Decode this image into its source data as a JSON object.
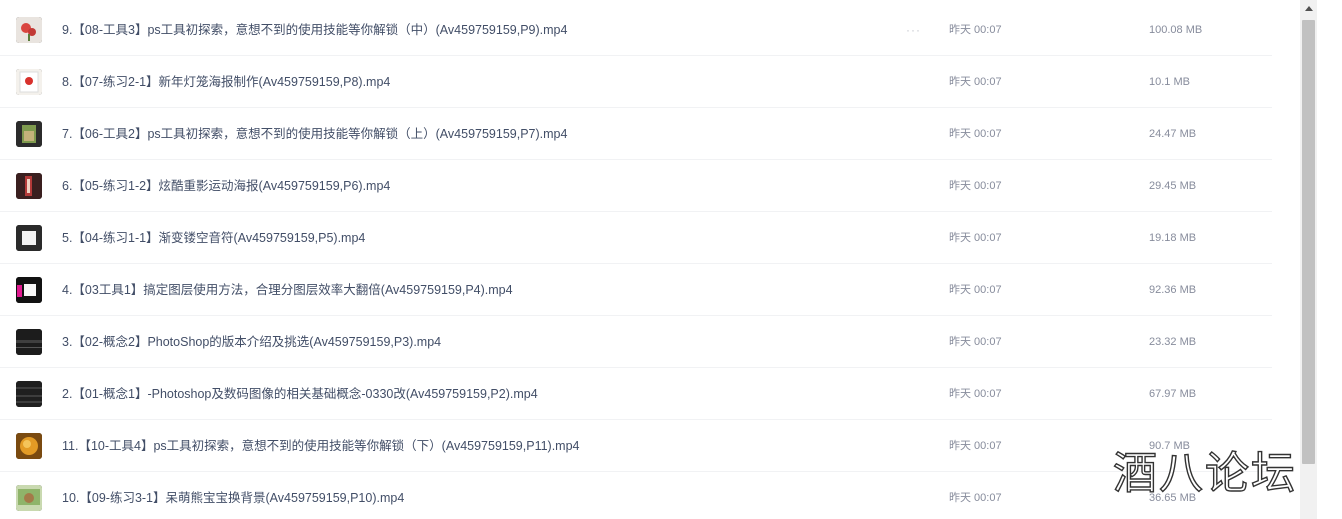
{
  "files": [
    {
      "name": "9.【08-工具3】ps工具初探索，意想不到的使用技能等你解锁（中）(Av459759159,P9).mp4",
      "date": "昨天 00:07",
      "size": "100.08 MB",
      "thumb": "flower-thumbnail"
    },
    {
      "name": "8.【07-练习2-1】新年灯笼海报制作(Av459759159,P8).mp4",
      "date": "昨天 00:07",
      "size": "10.1 MB",
      "thumb": "lantern-poster-thumbnail"
    },
    {
      "name": "7.【06-工具2】ps工具初探索，意想不到的使用技能等你解锁（上）(Av459759159,P7).mp4",
      "date": "昨天 00:07",
      "size": "24.47 MB",
      "thumb": "photo-thumbnail"
    },
    {
      "name": "6.【05-练习1-2】炫酷重影运动海报(Av459759159,P6).mp4",
      "date": "昨天 00:07",
      "size": "29.45 MB",
      "thumb": "sport-poster-thumbnail"
    },
    {
      "name": "5.【04-练习1-1】渐变镂空音符(Av459759159,P5).mp4",
      "date": "昨天 00:07",
      "size": "19.18 MB",
      "thumb": "note-thumbnail"
    },
    {
      "name": "4.【03工具1】搞定图层使用方法，合理分图层效率大翻倍(Av459759159,P4).mp4",
      "date": "昨天 00:07",
      "size": "92.36 MB",
      "thumb": "layers-thumbnail"
    },
    {
      "name": "3.【02-概念2】PhotoShop的版本介绍及挑选(Av459759159,P3).mp4",
      "date": "昨天 00:07",
      "size": "23.32 MB",
      "thumb": "dark-screen-thumbnail"
    },
    {
      "name": "2.【01-概念1】-Photoshop及数码图像的相关基础概念-0330改(Av459759159,P2).mp4",
      "date": "昨天 00:07",
      "size": "67.97 MB",
      "thumb": "dark-screen-thumbnail"
    },
    {
      "name": "11.【10-工具4】ps工具初探索，意想不到的使用技能等你解锁（下）(Av459759159,P11).mp4",
      "date": "昨天 00:07",
      "size": "90.7 MB",
      "thumb": "orange-photo-thumbnail"
    },
    {
      "name": "10.【09-练习3-1】呆萌熊宝宝换背景(Av459759159,P10).mp4",
      "date": "昨天 00:07",
      "size": "36.65 MB",
      "thumb": "bear-thumbnail"
    }
  ],
  "more_glyph": "···",
  "watermark": "酒八论坛"
}
